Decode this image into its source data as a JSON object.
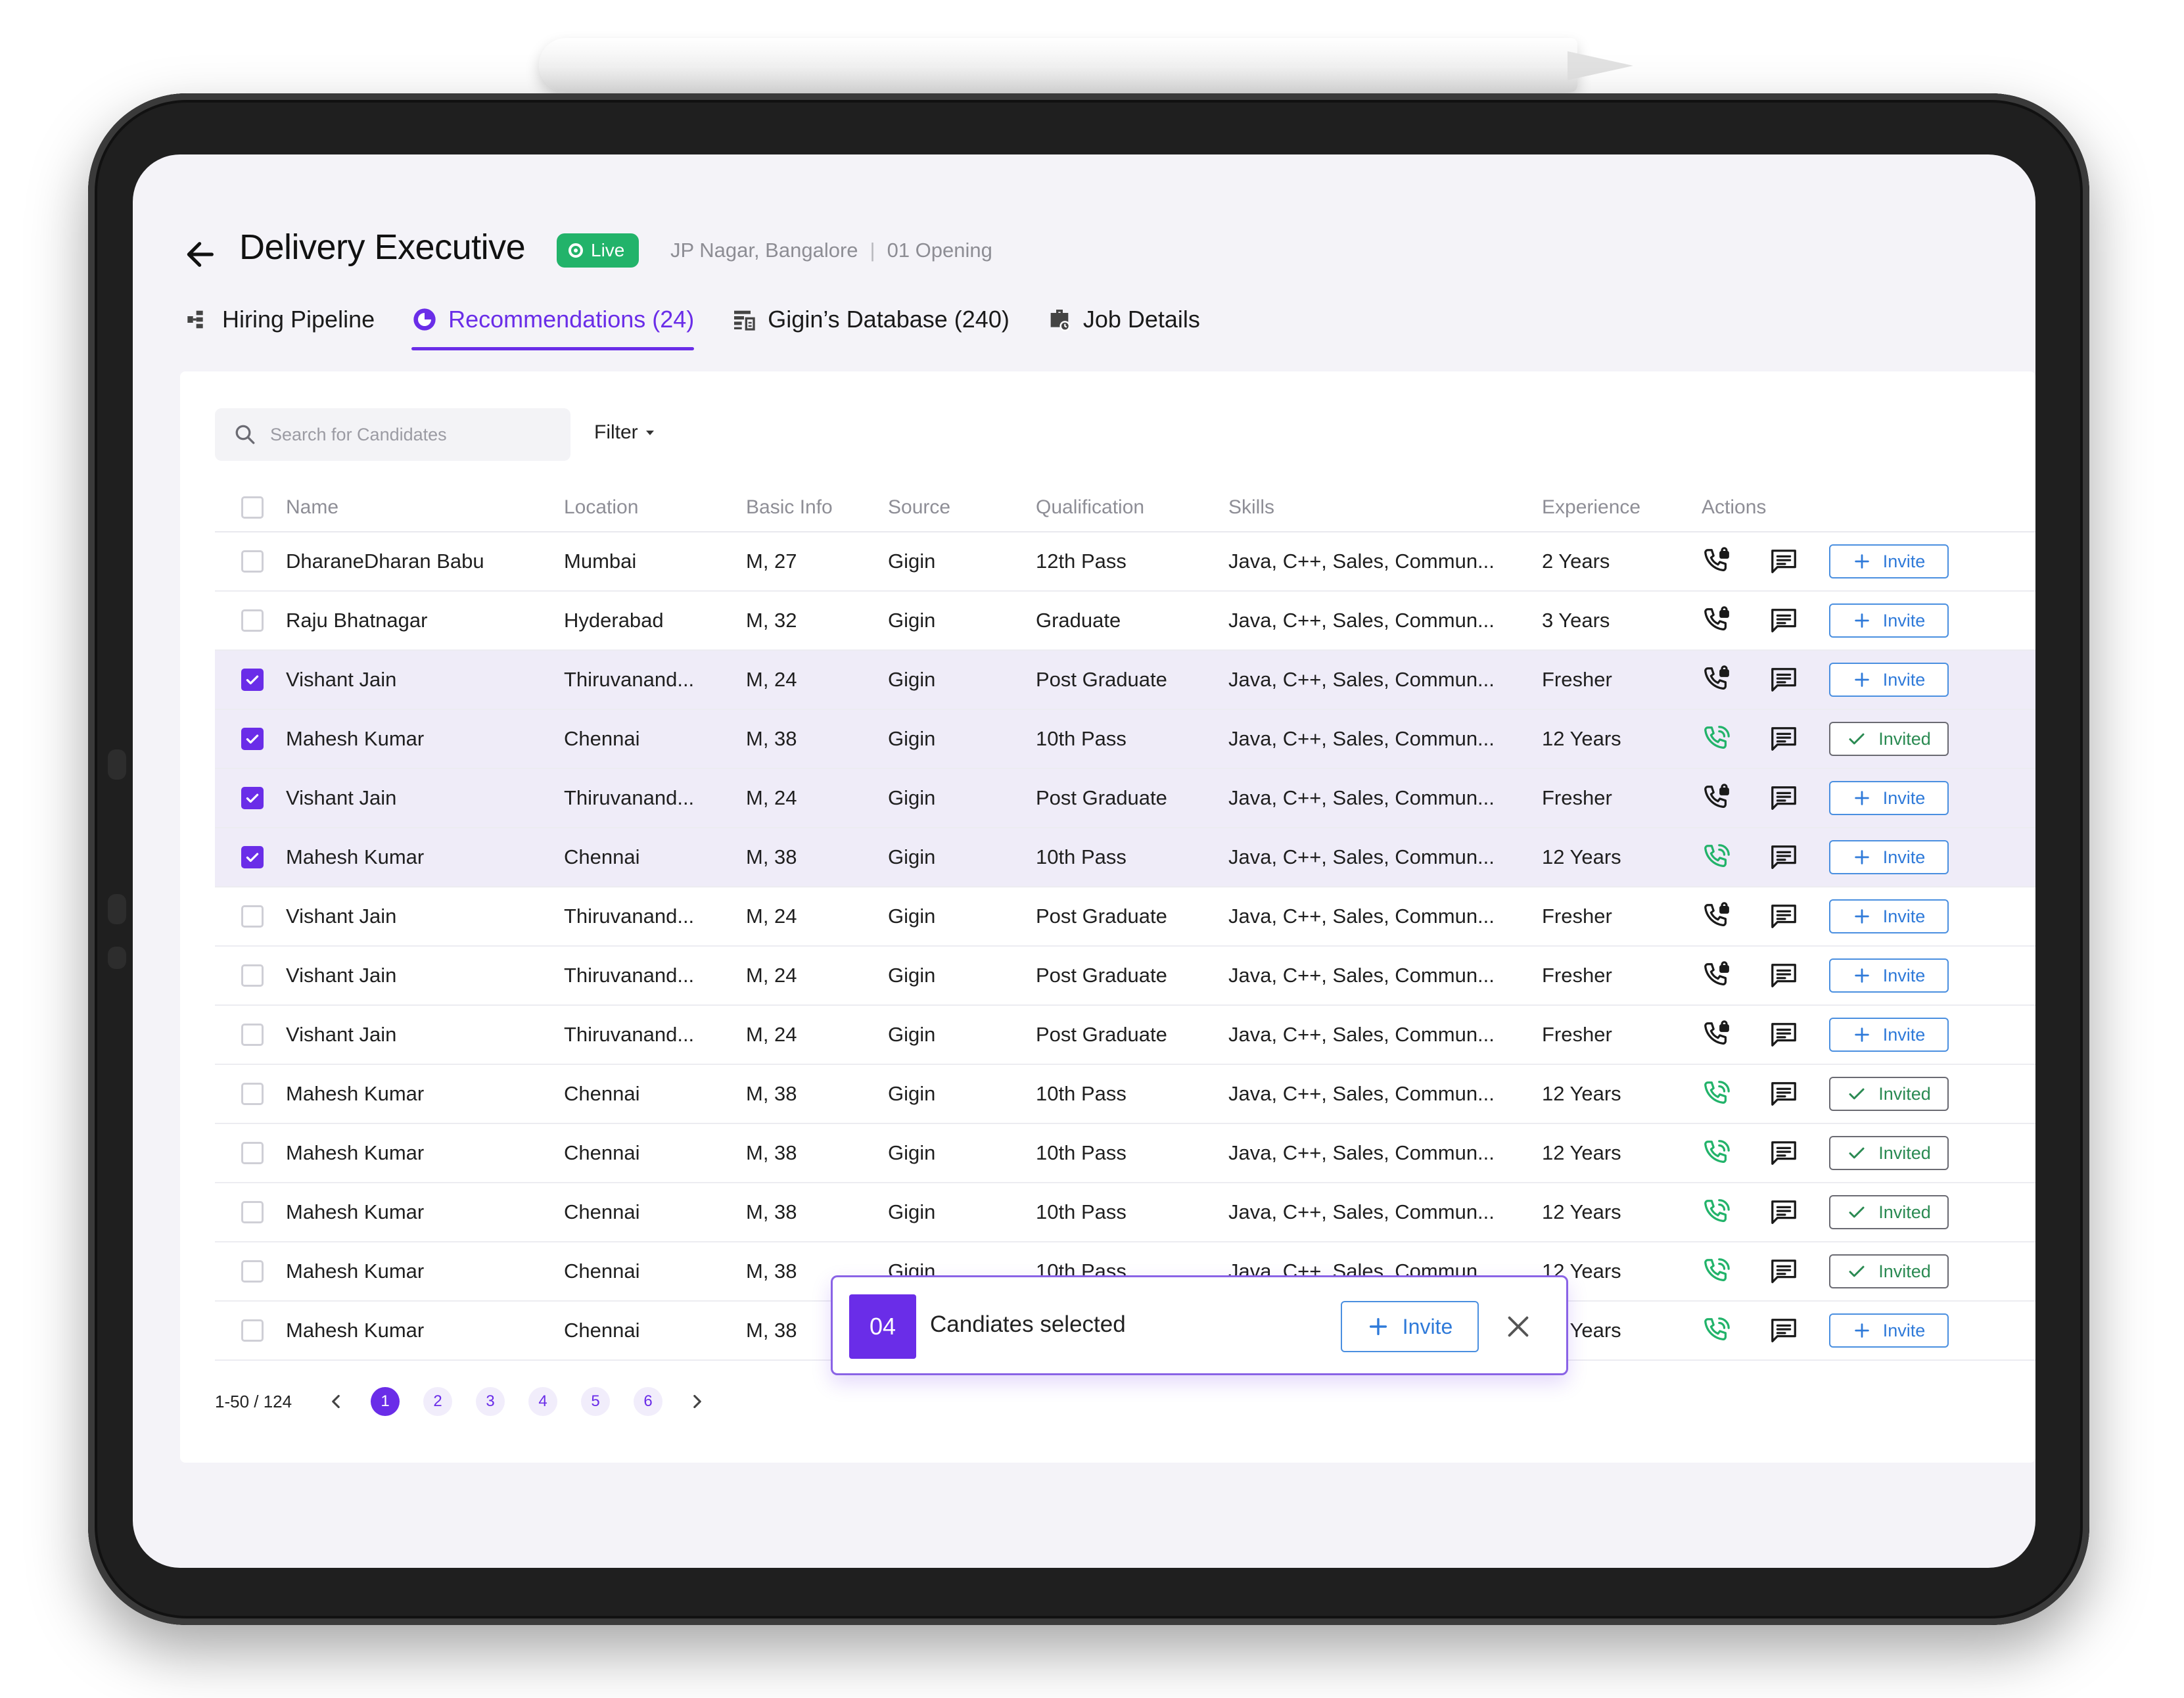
{
  "header": {
    "title": "Delivery Executive",
    "status": "Live",
    "location": "JP Nagar, Bangalore",
    "separator": "|",
    "openings": "01 Opening"
  },
  "tabs": [
    {
      "label": "Hiring Pipeline",
      "icon": "pipeline-icon",
      "active": false
    },
    {
      "label": "Recommendations (24)",
      "icon": "recommendations-icon",
      "active": true
    },
    {
      "label": "Gigin’s Database (240)",
      "icon": "database-icon",
      "active": false
    },
    {
      "label": "Job Details",
      "icon": "briefcase-icon",
      "active": false
    }
  ],
  "search": {
    "placeholder": "Search for Candidates"
  },
  "filter": {
    "label": "Filter"
  },
  "table": {
    "columns": [
      "Name",
      "Location",
      "Basic Info",
      "Source",
      "Qualification",
      "Skills",
      "Experience",
      "Actions"
    ],
    "rows": [
      {
        "name": "DharaneDharan Babu",
        "location": "Mumbai",
        "basic": "M, 27",
        "source": "Gigin",
        "qualification": "12th Pass",
        "skills": "Java, C++, Sales, Commun...",
        "experience": "2 Years",
        "selected": false,
        "called": false,
        "invited": false
      },
      {
        "name": "Raju Bhatnagar",
        "location": "Hyderabad",
        "basic": "M, 32",
        "source": "Gigin",
        "qualification": "Graduate",
        "skills": "Java, C++, Sales, Commun...",
        "experience": "3 Years",
        "selected": false,
        "called": false,
        "invited": false
      },
      {
        "name": "Vishant Jain",
        "location": "Thiruvanand...",
        "basic": "M, 24",
        "source": "Gigin",
        "qualification": "Post Graduate",
        "skills": "Java, C++, Sales, Commun...",
        "experience": "Fresher",
        "selected": true,
        "called": false,
        "invited": false
      },
      {
        "name": "Mahesh Kumar",
        "location": "Chennai",
        "basic": "M, 38",
        "source": "Gigin",
        "qualification": "10th Pass",
        "skills": "Java, C++, Sales, Commun...",
        "experience": "12 Years",
        "selected": true,
        "called": true,
        "invited": true
      },
      {
        "name": "Vishant Jain",
        "location": "Thiruvanand...",
        "basic": "M, 24",
        "source": "Gigin",
        "qualification": "Post Graduate",
        "skills": "Java, C++, Sales, Commun...",
        "experience": "Fresher",
        "selected": true,
        "called": false,
        "invited": false
      },
      {
        "name": "Mahesh Kumar",
        "location": "Chennai",
        "basic": "M, 38",
        "source": "Gigin",
        "qualification": "10th Pass",
        "skills": "Java, C++, Sales, Commun...",
        "experience": "12 Years",
        "selected": true,
        "called": true,
        "invited": false
      },
      {
        "name": "Vishant Jain",
        "location": "Thiruvanand...",
        "basic": "M, 24",
        "source": "Gigin",
        "qualification": "Post Graduate",
        "skills": "Java, C++, Sales, Commun...",
        "experience": "Fresher",
        "selected": false,
        "called": false,
        "invited": false
      },
      {
        "name": "Vishant Jain",
        "location": "Thiruvanand...",
        "basic": "M, 24",
        "source": "Gigin",
        "qualification": "Post Graduate",
        "skills": "Java, C++, Sales, Commun...",
        "experience": "Fresher",
        "selected": false,
        "called": false,
        "invited": false
      },
      {
        "name": "Vishant Jain",
        "location": "Thiruvanand...",
        "basic": "M, 24",
        "source": "Gigin",
        "qualification": "Post Graduate",
        "skills": "Java, C++, Sales, Commun...",
        "experience": "Fresher",
        "selected": false,
        "called": false,
        "invited": false
      },
      {
        "name": "Mahesh Kumar",
        "location": "Chennai",
        "basic": "M, 38",
        "source": "Gigin",
        "qualification": "10th Pass",
        "skills": "Java, C++, Sales, Commun...",
        "experience": "12 Years",
        "selected": false,
        "called": true,
        "invited": true
      },
      {
        "name": "Mahesh Kumar",
        "location": "Chennai",
        "basic": "M, 38",
        "source": "Gigin",
        "qualification": "10th Pass",
        "skills": "Java, C++, Sales, Commun...",
        "experience": "12 Years",
        "selected": false,
        "called": true,
        "invited": true
      },
      {
        "name": "Mahesh Kumar",
        "location": "Chennai",
        "basic": "M, 38",
        "source": "Gigin",
        "qualification": "10th Pass",
        "skills": "Java, C++, Sales, Commun...",
        "experience": "12 Years",
        "selected": false,
        "called": true,
        "invited": true
      },
      {
        "name": "Mahesh Kumar",
        "location": "Chennai",
        "basic": "M, 38",
        "source": "Gigin",
        "qualification": "10th Pass",
        "skills": "Java, C++, Sales, Commun...",
        "experience": "12 Years",
        "selected": false,
        "called": true,
        "invited": true
      },
      {
        "name": "Mahesh Kumar",
        "location": "Chennai",
        "basic": "M, 38",
        "source": "Gigin",
        "qualification": "10th Pass",
        "skills": "Java, C++, Sales, Commun...",
        "experience": "12 Years",
        "selected": false,
        "called": true,
        "invited": false
      }
    ],
    "invite_label": "Invite",
    "invited_label": "Invited"
  },
  "pagination": {
    "range": "1-50 / 124",
    "pages": [
      "1",
      "2",
      "3",
      "4",
      "5",
      "6"
    ],
    "current": "1"
  },
  "selection_bar": {
    "count": "04",
    "text": "Candiates selected",
    "invite_label": "Invite"
  },
  "colors": {
    "accent": "#6a2de8",
    "live": "#22b36a",
    "invite": "#2f7ad9",
    "called": "#22b36a"
  }
}
